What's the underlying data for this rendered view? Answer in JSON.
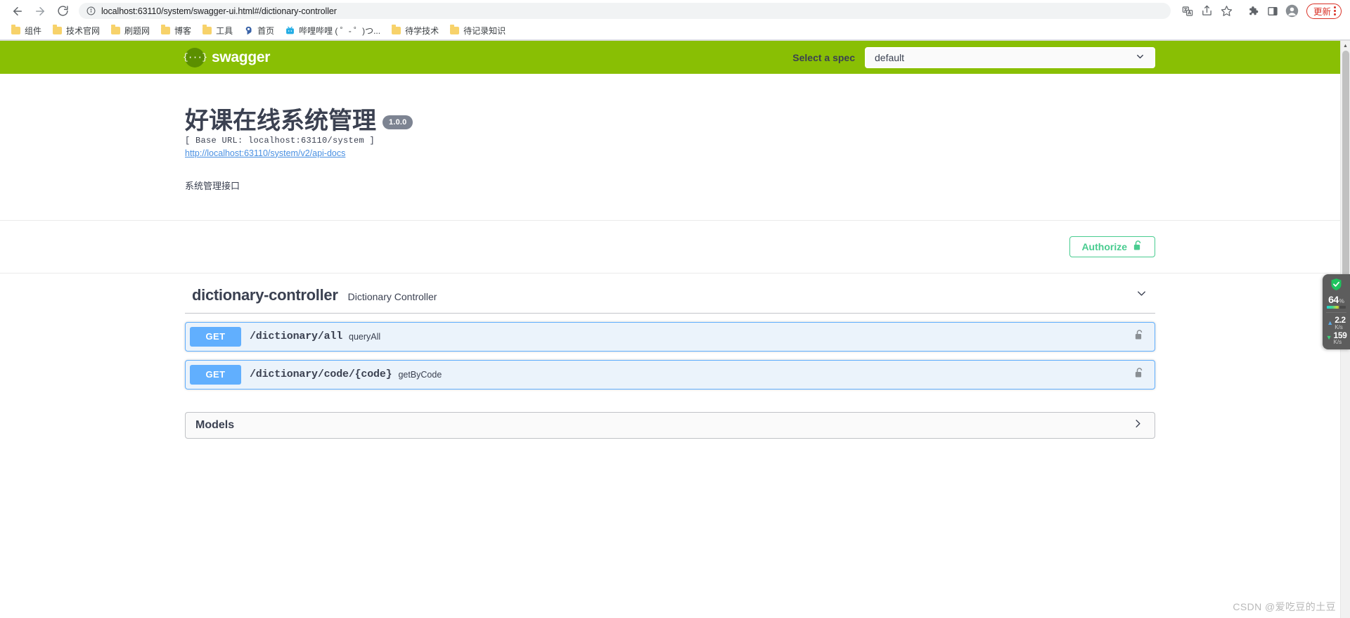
{
  "browser": {
    "back_icon": "back-arrow-icon",
    "forward_icon": "forward-arrow-icon",
    "reload_icon": "reload-icon",
    "site_info_icon": "info-circle-icon",
    "url": "localhost:63110/system/swagger-ui.html#/dictionary-controller",
    "toolbar_icons": [
      "translate-icon",
      "share-icon",
      "bookmark-star-icon",
      "extensions-puzzle-icon",
      "side-panel-icon",
      "profile-avatar-icon"
    ],
    "update_label": "更新",
    "bookmarks": [
      {
        "label": "组件",
        "icon": "folder-icon"
      },
      {
        "label": "技术官网",
        "icon": "folder-icon"
      },
      {
        "label": "刷题网",
        "icon": "folder-icon"
      },
      {
        "label": "博客",
        "icon": "folder-icon"
      },
      {
        "label": "工具",
        "icon": "folder-icon"
      },
      {
        "label": "首页",
        "icon": "site-favicon-icon"
      },
      {
        "label": "哔哩哔哩 ( ゜- ゜)つ...",
        "icon": "bilibili-favicon-icon"
      },
      {
        "label": "待学技术",
        "icon": "folder-icon"
      },
      {
        "label": "待记录知识",
        "icon": "folder-icon"
      }
    ]
  },
  "swagger": {
    "logo_text": "swagger",
    "logo_glyph": "{···}",
    "spec_label": "Select a spec",
    "spec_value": "default",
    "topbar_color": "#89bf04",
    "title": "好课在线系统管理",
    "version": "1.0.0",
    "base_url": "[ Base URL: localhost:63110/system ]",
    "api_docs_link": "http://localhost:63110/system/v2/api-docs",
    "description": "系统管理接口",
    "authorize_label": "Authorize",
    "authorize_color": "#49cc90",
    "tag": {
      "name": "dictionary-controller",
      "description": "Dictionary Controller"
    },
    "operations": [
      {
        "method": "GET",
        "path": "/dictionary/all",
        "summary": "queryAll",
        "method_color": "#61affe",
        "lock_icon": "unlocked-padlock-icon"
      },
      {
        "method": "GET",
        "path": "/dictionary/code/{code}",
        "summary": "getByCode",
        "method_color": "#61affe",
        "lock_icon": "unlocked-padlock-icon"
      }
    ],
    "models_label": "Models"
  },
  "net_widget": {
    "shield_icon": "green-shield-check-icon",
    "percent": "64",
    "percent_symbol": "%",
    "upload_value": "2.2",
    "upload_unit": "K/s",
    "download_value": "159",
    "download_unit": "K/s"
  },
  "watermark": "CSDN @爱吃豆的土豆"
}
